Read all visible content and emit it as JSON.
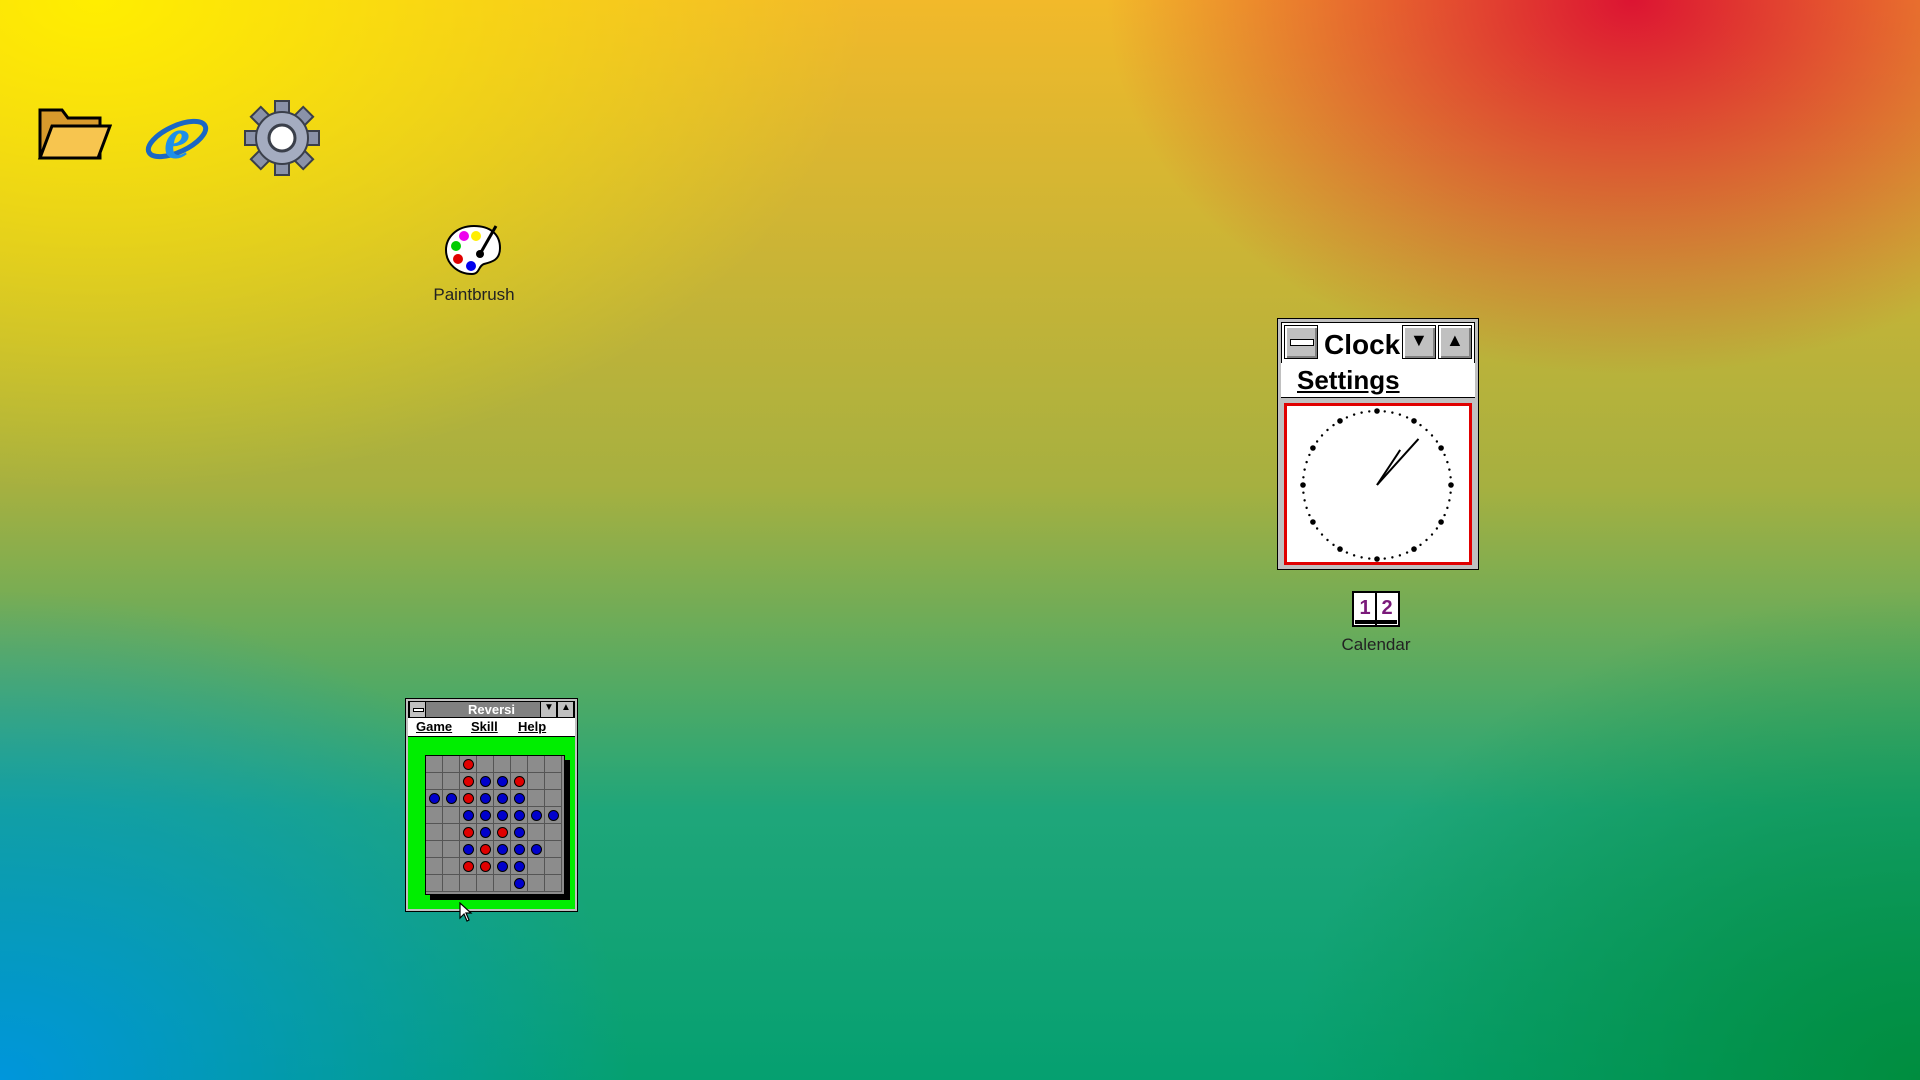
{
  "desktop": {
    "background_colors": [
      "#ffee00",
      "#dc1432",
      "#0096dc",
      "#008c3c"
    ],
    "icons": [
      {
        "id": "folder",
        "icon": "folder-icon",
        "label": ""
      },
      {
        "id": "ie",
        "icon": "internet-explorer-icon",
        "label": ""
      },
      {
        "id": "settings",
        "icon": "gear-icon",
        "label": ""
      },
      {
        "id": "paintbrush",
        "icon": "paint-palette-icon",
        "label": "Paintbrush"
      },
      {
        "id": "calendar",
        "icon": "calendar-icon",
        "label": "Calendar"
      }
    ]
  },
  "clock_window": {
    "title": "Clock",
    "menu": {
      "settings_label": "Settings"
    },
    "time": {
      "hour": 1,
      "minute": 7
    },
    "border_color": "#e00000"
  },
  "reversi_window": {
    "title": "Reversi",
    "menu": [
      "Game",
      "Skill",
      "Help"
    ],
    "board_color": "#8c8c8c",
    "background_color": "#00ee00",
    "board": [
      "..R.....",
      "..RBBR..",
      "BBRBBB..",
      "..BBBBBB",
      "..RBRB..",
      "..BRBBB.",
      "..RRBB..",
      ".....B.."
    ],
    "colors": {
      "R": "#e00000",
      "B": "#0000cc"
    }
  }
}
